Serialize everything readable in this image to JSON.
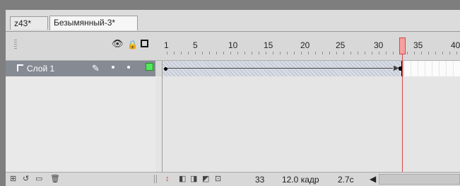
{
  "tabs": [
    {
      "label": "z43*"
    },
    {
      "label": "Безымянный-3*"
    }
  ],
  "ruler": {
    "labels": [
      "1",
      "5",
      "10",
      "15",
      "20",
      "25",
      "30",
      "35",
      "40"
    ],
    "current_frame": "33"
  },
  "layer": {
    "name": "Слой 1"
  },
  "status": {
    "current_frame": "33",
    "frame_rate": "12.0 кадр",
    "elapsed_time": "2.7c"
  },
  "icons": {
    "eye": "eye-icon",
    "lock": "lock-icon",
    "outline": "outline-icon",
    "pencil": "pencil-icon"
  },
  "colors": {
    "playhead": "#f6a0a0",
    "layer_selected": "#858a93",
    "layer_outline": "#57e65d"
  }
}
